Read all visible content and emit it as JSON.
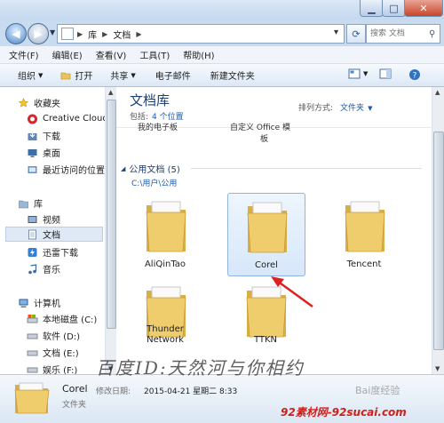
{
  "titlebar": {
    "min": "▁",
    "max": "□",
    "close": "✕"
  },
  "address": {
    "crumbs": [
      "库",
      "文档"
    ],
    "search_placeholder": "搜索 文档"
  },
  "menu": [
    "文件(F)",
    "编辑(E)",
    "查看(V)",
    "工具(T)",
    "帮助(H)"
  ],
  "toolbar": {
    "organize": "组织",
    "open": "打开",
    "share": "共享",
    "email": "电子邮件",
    "new_folder": "新建文件夹"
  },
  "nav": {
    "favorites": "收藏夹",
    "creative_cloud": "Creative Cloud",
    "downloads": "下载",
    "desktop": "桌面",
    "recent": "最近访问的位置",
    "libraries": "库",
    "videos": "视频",
    "documents": "文档",
    "thunder": "迅雷下载",
    "music": "音乐",
    "computer": "计算机",
    "drive_c": "本地磁盘 (C:)",
    "drive_d": "软件 (D:)",
    "drive_e": "文档 (E:)",
    "drive_f": "娱乐 (F:)"
  },
  "content": {
    "library_title": "文档库",
    "includes_label": "包括:",
    "includes_link": "4 个位置",
    "sort_label": "排列方式:",
    "sort_value": "文件夹",
    "cut_label_1": "我的电子板",
    "cut_label_2": "自定义 Office 模",
    "cut_label_2b": "板",
    "group_title": "公用文档 (5)",
    "group_path": "C:\\用户\\公用",
    "folders": [
      "AliQinTao",
      "Corel",
      "Tencent",
      "Thunder Network",
      "TTKN"
    ]
  },
  "details": {
    "name": "Corel",
    "modified_label": "修改日期:",
    "modified_value": "2015-04-21 星期二 8:33",
    "type": "文件夹"
  },
  "watermark": {
    "text": "百度ID:天然河与你相约",
    "baidu": "Bai度经验",
    "site": "92素材网-92sucai.com"
  },
  "colors": {
    "accent": "#1e5aa6",
    "title": "#1e3f74",
    "arrow": "#e02020"
  }
}
